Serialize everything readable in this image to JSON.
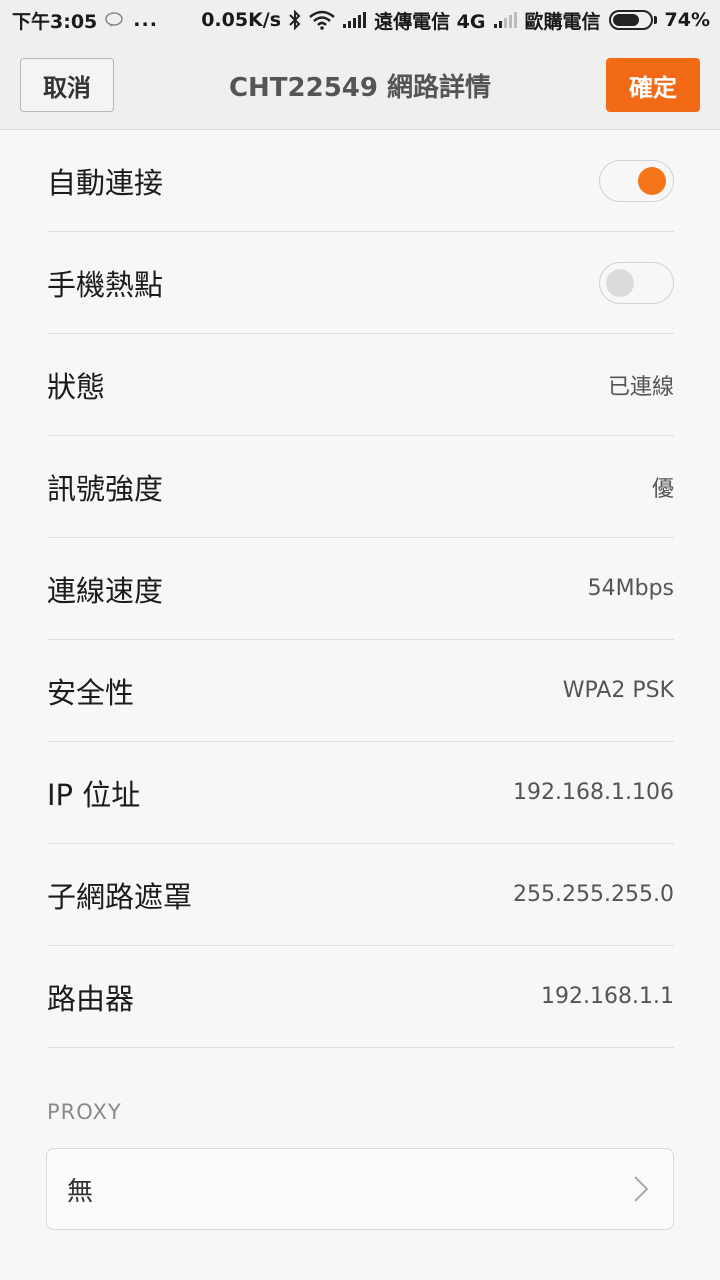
{
  "status_bar": {
    "time": "下午3:05",
    "dots": "...",
    "net_speed": "0.05K/s",
    "carrier1": "遠傳電信 4G",
    "carrier2": "歐購電信",
    "battery": "74%",
    "battery_level": 0.74,
    "icons": [
      "line-icon",
      "bluetooth-icon",
      "wifi-icon",
      "signal-icon",
      "signal-weak-icon",
      "battery-icon"
    ]
  },
  "header": {
    "cancel_label": "取消",
    "title": "CHT22549 網路詳情",
    "confirm_label": "確定",
    "accent_color": "#f26a16"
  },
  "settings": {
    "auto_connect": {
      "label": "自動連接",
      "enabled": true
    },
    "hotspot": {
      "label": "手機熱點",
      "enabled": false
    },
    "status": {
      "label": "狀態",
      "value": "已連線"
    },
    "signal": {
      "label": "訊號強度",
      "value": "優"
    },
    "speed": {
      "label": "連線速度",
      "value": "54Mbps"
    },
    "security": {
      "label": "安全性",
      "value": "WPA2 PSK"
    },
    "ip": {
      "label": "IP 位址",
      "value": "192.168.1.106"
    },
    "subnet": {
      "label": "子網路遮罩",
      "value": "255.255.255.0"
    },
    "router": {
      "label": "路由器",
      "value": "192.168.1.1"
    }
  },
  "proxy": {
    "header": "PROXY",
    "value": "無"
  }
}
